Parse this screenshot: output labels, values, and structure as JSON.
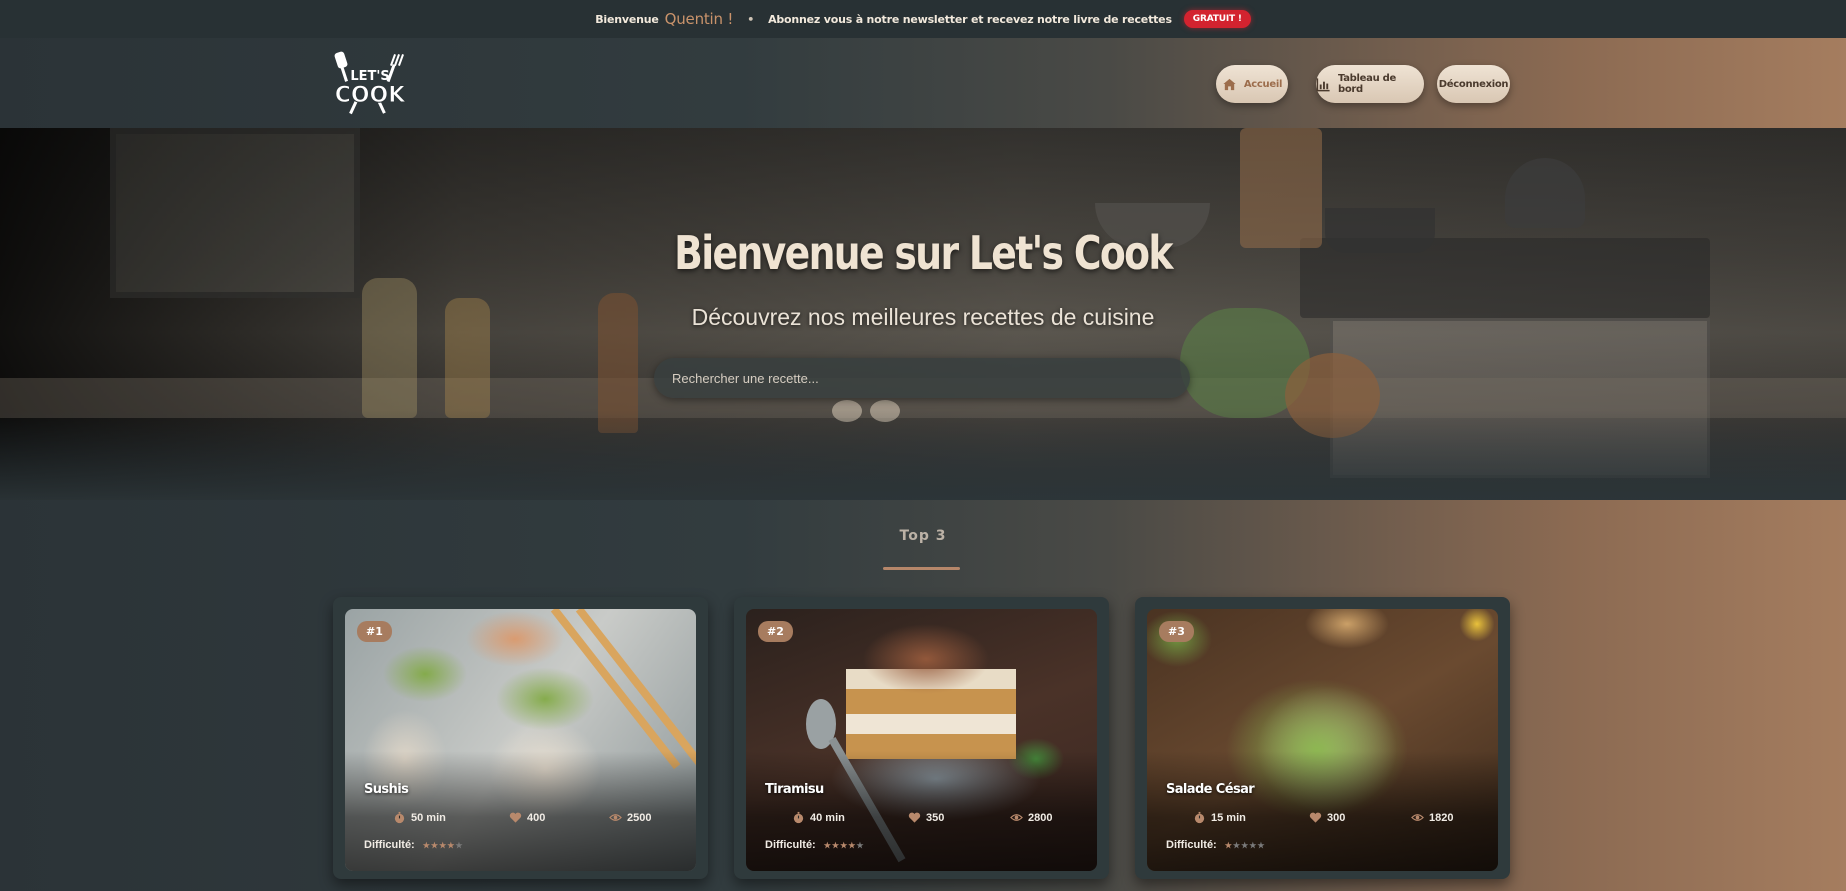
{
  "topbar": {
    "welcome": "Bienvenue",
    "username": "Quentin !",
    "separator": "•",
    "newsletter": "Abonnez vous à notre newsletter et recevez notre livre de recettes",
    "badge": "GRATUIT !"
  },
  "header": {
    "logo_text": "LET'S COOK",
    "nav": [
      {
        "label": "Accueil",
        "icon": "home-icon",
        "active": true
      },
      {
        "label": "Tableau de bord",
        "icon": "bar-chart-icon",
        "active": false
      },
      {
        "label": "Déconnexion",
        "active": false
      }
    ]
  },
  "hero": {
    "title": "Bienvenue sur Let's Cook",
    "subtitle": "Découvrez nos meilleures recettes de cuisine",
    "search_placeholder": "Rechercher une recette..."
  },
  "section": {
    "title": "Top 3"
  },
  "difficulty_label": "Difficulté:",
  "cards": [
    {
      "rank": "#1",
      "title": "Sushis",
      "time": "50 min",
      "likes": "400",
      "views": "2500",
      "difficulty": 4
    },
    {
      "rank": "#2",
      "title": "Tiramisu",
      "time": "40 min",
      "likes": "350",
      "views": "2800",
      "difficulty": 4
    },
    {
      "rank": "#3",
      "title": "Salade César",
      "time": "15 min",
      "likes": "300",
      "views": "1820",
      "difficulty": 1
    }
  ],
  "colors": {
    "accent": "#a77c5f",
    "badge_red": "#d3232f",
    "card_bg": "#2f3a3c"
  }
}
